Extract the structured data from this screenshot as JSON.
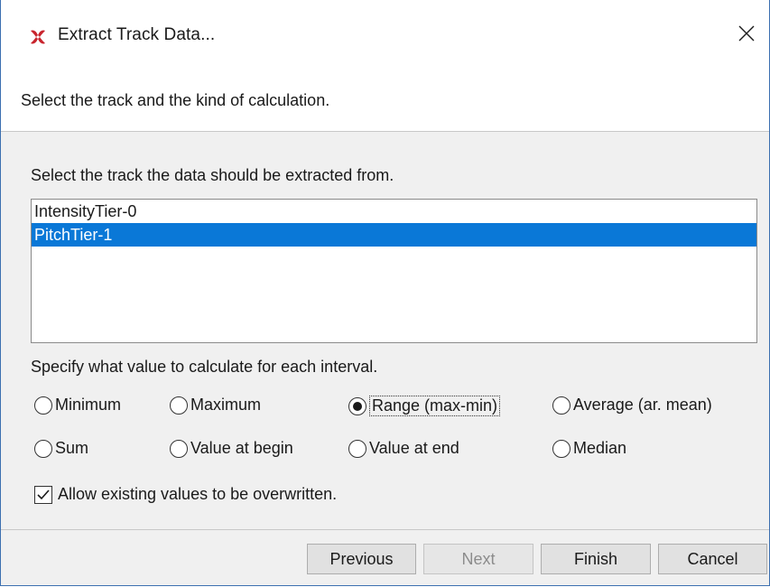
{
  "window": {
    "title": "Extract Track Data...",
    "app_icon": "elan-logo-icon",
    "close_icon": "close-icon"
  },
  "header": {
    "message": "Select the track and the kind of calculation."
  },
  "tracks": {
    "label": "Select the track the data should be extracted from.",
    "items": [
      "IntensityTier-0",
      "PitchTier-1"
    ],
    "selected": "PitchTier-1"
  },
  "calculation": {
    "label": "Specify what value to calculate for each interval.",
    "options": [
      {
        "label": "Minimum",
        "checked": false
      },
      {
        "label": "Maximum",
        "checked": false
      },
      {
        "label": "Range (max-min)",
        "checked": true
      },
      {
        "label": "Average (ar. mean)",
        "checked": false
      },
      {
        "label": "Sum",
        "checked": false
      },
      {
        "label": "Value at begin",
        "checked": false
      },
      {
        "label": "Value at end",
        "checked": false
      },
      {
        "label": "Median",
        "checked": false
      }
    ]
  },
  "overwrite": {
    "label": "Allow existing values to be overwritten.",
    "checked": true
  },
  "buttons": {
    "previous": "Previous",
    "next": "Next",
    "finish": "Finish",
    "cancel": "Cancel"
  },
  "colors": {
    "selection": "#0a78d7",
    "window_border": "#3c6fb0",
    "icon_red": "#c8232c"
  }
}
